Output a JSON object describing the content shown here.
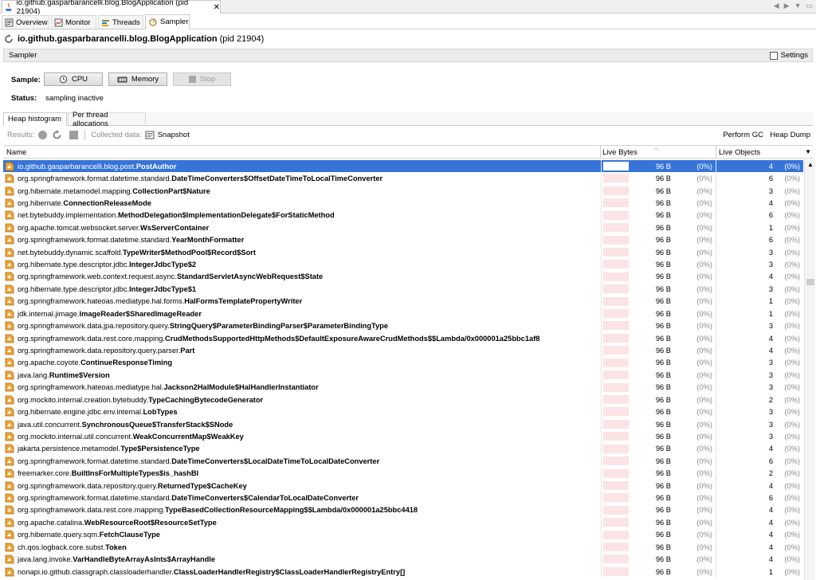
{
  "tabs": {
    "window_title": "io.github.gasparbarancelli.blog.BlogApplication (pid 21904)",
    "items": [
      {
        "label": "Overview"
      },
      {
        "label": "Monitor"
      },
      {
        "label": "Threads"
      },
      {
        "label": "Sampler"
      }
    ]
  },
  "header": {
    "title": "io.github.gasparbarancelli.blog.BlogApplication",
    "pid": "(pid 21904)"
  },
  "section": {
    "title": "Sampler",
    "settings_label": "Settings"
  },
  "sample": {
    "label": "Sample:",
    "cpu_label": "CPU",
    "memory_label": "Memory",
    "stop_label": "Stop",
    "status_label": "Status:",
    "status_value": "sampling inactive"
  },
  "subtabs": {
    "items": [
      {
        "label": "Heap histogram"
      },
      {
        "label": "Per thread allocations"
      }
    ]
  },
  "results_bar": {
    "results_label": "Results:",
    "collected_label": "Collected data:",
    "snapshot_label": "Snapshot",
    "perform_gc": "Perform GC",
    "heap_dump": "Heap Dump"
  },
  "table": {
    "columns": {
      "name": "Name",
      "live_bytes": "Live Bytes",
      "live_objects": "Live Objects"
    },
    "rows": [
      {
        "pkg": "io.github.gasparbarancelli.blog.post.",
        "cls": "PostAuthor",
        "bytes": "96 B",
        "bpct": "(0%)",
        "objs": "4",
        "opct": "(0%)"
      },
      {
        "pkg": "org.springframework.format.datetime.standard.",
        "cls": "DateTimeConverters$OffsetDateTimeToLocalTimeConverter",
        "bytes": "96 B",
        "bpct": "(0%)",
        "objs": "6",
        "opct": "(0%)"
      },
      {
        "pkg": "org.hibernate.metamodel.mapping.",
        "cls": "CollectionPart$Nature",
        "bytes": "96 B",
        "bpct": "(0%)",
        "objs": "3",
        "opct": "(0%)"
      },
      {
        "pkg": "org.hibernate.",
        "cls": "ConnectionReleaseMode",
        "bytes": "96 B",
        "bpct": "(0%)",
        "objs": "4",
        "opct": "(0%)"
      },
      {
        "pkg": "net.bytebuddy.implementation.",
        "cls": "MethodDelegation$ImplementationDelegate$ForStaticMethod",
        "bytes": "96 B",
        "bpct": "(0%)",
        "objs": "6",
        "opct": "(0%)"
      },
      {
        "pkg": "org.apache.tomcat.websocket.server.",
        "cls": "WsServerContainer",
        "bytes": "96 B",
        "bpct": "(0%)",
        "objs": "1",
        "opct": "(0%)"
      },
      {
        "pkg": "org.springframework.format.datetime.standard.",
        "cls": "YearMonthFormatter",
        "bytes": "96 B",
        "bpct": "(0%)",
        "objs": "6",
        "opct": "(0%)"
      },
      {
        "pkg": "net.bytebuddy.dynamic.scaffold.",
        "cls": "TypeWriter$MethodPool$Record$Sort",
        "bytes": "96 B",
        "bpct": "(0%)",
        "objs": "3",
        "opct": "(0%)"
      },
      {
        "pkg": "org.hibernate.type.descriptor.jdbc.",
        "cls": "IntegerJdbcType$2",
        "bytes": "96 B",
        "bpct": "(0%)",
        "objs": "3",
        "opct": "(0%)"
      },
      {
        "pkg": "org.springframework.web.context.request.async.",
        "cls": "StandardServletAsyncWebRequest$State",
        "bytes": "96 B",
        "bpct": "(0%)",
        "objs": "4",
        "opct": "(0%)"
      },
      {
        "pkg": "org.hibernate.type.descriptor.jdbc.",
        "cls": "IntegerJdbcType$1",
        "bytes": "96 B",
        "bpct": "(0%)",
        "objs": "3",
        "opct": "(0%)"
      },
      {
        "pkg": "org.springframework.hateoas.mediatype.hal.forms.",
        "cls": "HalFormsTemplatePropertyWriter",
        "bytes": "96 B",
        "bpct": "(0%)",
        "objs": "1",
        "opct": "(0%)"
      },
      {
        "pkg": "jdk.internal.jimage.",
        "cls": "ImageReader$SharedImageReader",
        "bytes": "96 B",
        "bpct": "(0%)",
        "objs": "1",
        "opct": "(0%)"
      },
      {
        "pkg": "org.springframework.data.jpa.repository.query.",
        "cls": "StringQuery$ParameterBindingParser$ParameterBindingType",
        "bytes": "96 B",
        "bpct": "(0%)",
        "objs": "3",
        "opct": "(0%)"
      },
      {
        "pkg": "org.springframework.data.rest.core.mapping.",
        "cls": "CrudMethodsSupportedHttpMethods$DefaultExposureAwareCrudMethods$$Lambda/0x000001a25bbc1af8",
        "bytes": "96 B",
        "bpct": "(0%)",
        "objs": "4",
        "opct": "(0%)"
      },
      {
        "pkg": "org.springframework.data.repository.query.parser.",
        "cls": "Part",
        "bytes": "96 B",
        "bpct": "(0%)",
        "objs": "4",
        "opct": "(0%)"
      },
      {
        "pkg": "org.apache.coyote.",
        "cls": "ContinueResponseTiming",
        "bytes": "96 B",
        "bpct": "(0%)",
        "objs": "3",
        "opct": "(0%)"
      },
      {
        "pkg": "java.lang.",
        "cls": "Runtime$Version",
        "bytes": "96 B",
        "bpct": "(0%)",
        "objs": "3",
        "opct": "(0%)"
      },
      {
        "pkg": "org.springframework.hateoas.mediatype.hal.",
        "cls": "Jackson2HalModule$HalHandlerInstantiator",
        "bytes": "96 B",
        "bpct": "(0%)",
        "objs": "3",
        "opct": "(0%)"
      },
      {
        "pkg": "org.mockito.internal.creation.bytebuddy.",
        "cls": "TypeCachingBytecodeGenerator",
        "bytes": "96 B",
        "bpct": "(0%)",
        "objs": "2",
        "opct": "(0%)"
      },
      {
        "pkg": "org.hibernate.engine.jdbc.env.internal.",
        "cls": "LobTypes",
        "bytes": "96 B",
        "bpct": "(0%)",
        "objs": "3",
        "opct": "(0%)"
      },
      {
        "pkg": "java.util.concurrent.",
        "cls": "SynchronousQueue$TransferStack$SNode",
        "bytes": "96 B",
        "bpct": "(0%)",
        "objs": "3",
        "opct": "(0%)"
      },
      {
        "pkg": "org.mockito.internal.util.concurrent.",
        "cls": "WeakConcurrentMap$WeakKey",
        "bytes": "96 B",
        "bpct": "(0%)",
        "objs": "3",
        "opct": "(0%)"
      },
      {
        "pkg": "jakarta.persistence.metamodel.",
        "cls": "Type$PersistenceType",
        "bytes": "96 B",
        "bpct": "(0%)",
        "objs": "4",
        "opct": "(0%)"
      },
      {
        "pkg": "org.springframework.format.datetime.standard.",
        "cls": "DateTimeConverters$LocalDateTimeToLocalDateConverter",
        "bytes": "96 B",
        "bpct": "(0%)",
        "objs": "6",
        "opct": "(0%)"
      },
      {
        "pkg": "freemarker.core.",
        "cls": "BuiltInsForMultipleTypes$is_hashBI",
        "bytes": "96 B",
        "bpct": "(0%)",
        "objs": "2",
        "opct": "(0%)"
      },
      {
        "pkg": "org.springframework.data.repository.query.",
        "cls": "ReturnedType$CacheKey",
        "bytes": "96 B",
        "bpct": "(0%)",
        "objs": "4",
        "opct": "(0%)"
      },
      {
        "pkg": "org.springframework.format.datetime.standard.",
        "cls": "DateTimeConverters$CalendarToLocalDateConverter",
        "bytes": "96 B",
        "bpct": "(0%)",
        "objs": "6",
        "opct": "(0%)"
      },
      {
        "pkg": "org.springframework.data.rest.core.mapping.",
        "cls": "TypeBasedCollectionResourceMapping$$Lambda/0x000001a25bbc4418",
        "bytes": "96 B",
        "bpct": "(0%)",
        "objs": "4",
        "opct": "(0%)"
      },
      {
        "pkg": "org.apache.catalina.",
        "cls": "WebResourceRoot$ResourceSetType",
        "bytes": "96 B",
        "bpct": "(0%)",
        "objs": "4",
        "opct": "(0%)"
      },
      {
        "pkg": "org.hibernate.query.sqm.",
        "cls": "FetchClauseType",
        "bytes": "96 B",
        "bpct": "(0%)",
        "objs": "4",
        "opct": "(0%)"
      },
      {
        "pkg": "ch.qos.logback.core.subst.",
        "cls": "Token",
        "bytes": "96 B",
        "bpct": "(0%)",
        "objs": "4",
        "opct": "(0%)"
      },
      {
        "pkg": "java.lang.invoke.",
        "cls": "VarHandleByteArrayAsInts$ArrayHandle",
        "bytes": "96 B",
        "bpct": "(0%)",
        "objs": "4",
        "opct": "(0%)"
      },
      {
        "pkg": "nonapi.io.github.classgraph.classloaderhandler.",
        "cls": "ClassLoaderHandlerRegistry$ClassLoaderHandlerRegistryEntry[]",
        "bytes": "96 B",
        "bpct": "(0%)",
        "objs": "1",
        "opct": "(0%)"
      }
    ]
  },
  "colors": {
    "selection": "#3874d8",
    "bar": "#fbe3e6",
    "accent": "#1a5fb4"
  }
}
